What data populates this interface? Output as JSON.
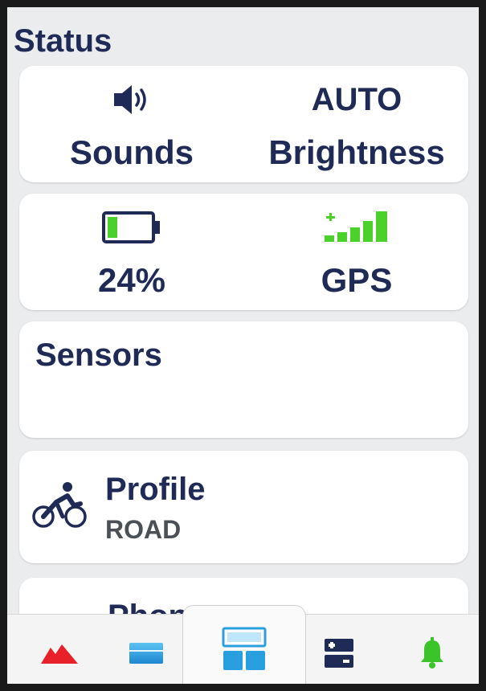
{
  "header": {
    "title": "Status"
  },
  "controls": {
    "sounds": {
      "label": "Sounds",
      "icon": "speaker-icon"
    },
    "brightness": {
      "value": "AUTO",
      "label": "Brightness"
    }
  },
  "status": {
    "battery": {
      "value": "24%",
      "level": 0.24,
      "icon": "battery-icon",
      "fill_color": "#4cd12a"
    },
    "gps": {
      "label": "GPS",
      "icon": "gps-signal-icon",
      "color": "#4cd12a"
    }
  },
  "sensors": {
    "title": "Sensors"
  },
  "profile": {
    "title": "Profile",
    "value": "ROAD",
    "icon": "cyclist-icon"
  },
  "phone": {
    "title": "Phone"
  },
  "nav": {
    "items": [
      {
        "icon": "mountain-icon",
        "color": "#e8202a"
      },
      {
        "icon": "card-icon",
        "color": "#2a9fe0"
      },
      {
        "icon": "widgets-icon",
        "color": "#2a9fe0",
        "active": true
      },
      {
        "icon": "controls-icon",
        "color": "#1f2a56"
      },
      {
        "icon": "bell-icon",
        "color": "#3bc42a"
      }
    ]
  },
  "colors": {
    "text": "#1f2a56",
    "accent_green": "#4cd12a",
    "card": "#ffffff",
    "background": "#ebecee"
  }
}
